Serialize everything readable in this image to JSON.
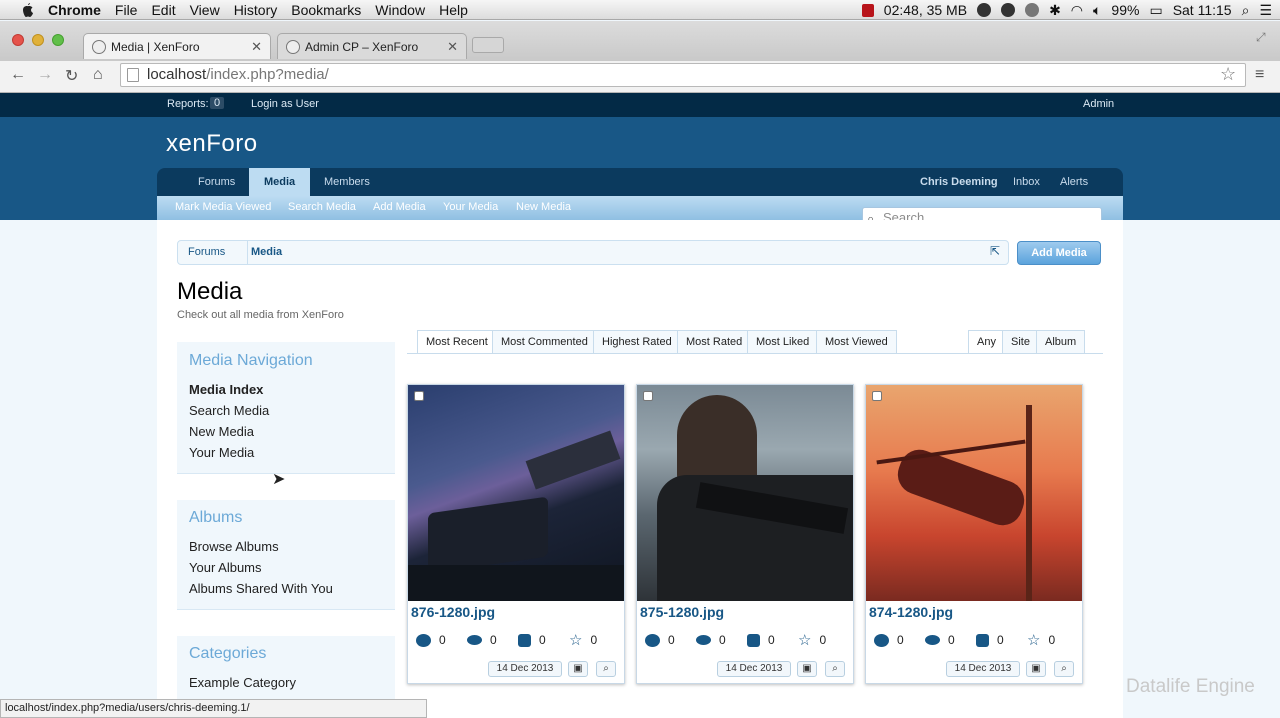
{
  "menubar": {
    "app": "Chrome",
    "items": [
      "File",
      "Edit",
      "View",
      "History",
      "Bookmarks",
      "Window",
      "Help"
    ],
    "status": "02:48, 35 MB",
    "battery": "99%",
    "clock": "Sat 11:15"
  },
  "browser": {
    "tabs": [
      {
        "title": "Media | XenForo"
      },
      {
        "title": "Admin CP – XenForo"
      }
    ],
    "url_host": "localhost",
    "url_path": "/index.php?media/",
    "status_url": "localhost/index.php?media/users/chris-deeming.1/"
  },
  "site": {
    "topbar": {
      "reports_label": "Reports:",
      "reports_count": "0",
      "login_as": "Login as User",
      "admin": "Admin"
    },
    "logo": "xenForo",
    "nav": [
      "Forums",
      "Media",
      "Members"
    ],
    "nav_right": [
      "Chris Deeming",
      "Inbox",
      "Alerts"
    ],
    "subnav": [
      "Mark Media Viewed",
      "Search Media",
      "Add Media",
      "Your Media",
      "New Media"
    ],
    "search_placeholder": "Search...",
    "breadcrumbs": [
      "Forums",
      "Media"
    ],
    "add_media": "Add Media",
    "page_title": "Media",
    "page_desc": "Check out all media from XenForo"
  },
  "sidebar": {
    "nav_title": "Media Navigation",
    "nav_items": [
      "Media Index",
      "Search Media",
      "New Media",
      "Your Media"
    ],
    "albums_title": "Albums",
    "album_items": [
      "Browse Albums",
      "Your Albums",
      "Albums Shared With You"
    ],
    "categories_title": "Categories",
    "category_items": [
      "Example Category"
    ]
  },
  "filters": {
    "sort": [
      "Most Recent",
      "Most Commented",
      "Highest Rated",
      "Most Rated",
      "Most Liked",
      "Most Viewed"
    ],
    "scope": [
      "Any",
      "Site",
      "Album"
    ]
  },
  "media": [
    {
      "title": "876-1280.jpg",
      "comments": "0",
      "views": "0",
      "likes": "0",
      "rating": "0",
      "date": "14 Dec 2013"
    },
    {
      "title": "875-1280.jpg",
      "comments": "0",
      "views": "0",
      "likes": "0",
      "rating": "0",
      "date": "14 Dec 2013"
    },
    {
      "title": "874-1280.jpg",
      "comments": "0",
      "views": "0",
      "likes": "0",
      "rating": "0",
      "date": "14 Dec 2013"
    }
  ],
  "watermark": "Datalife Engine"
}
